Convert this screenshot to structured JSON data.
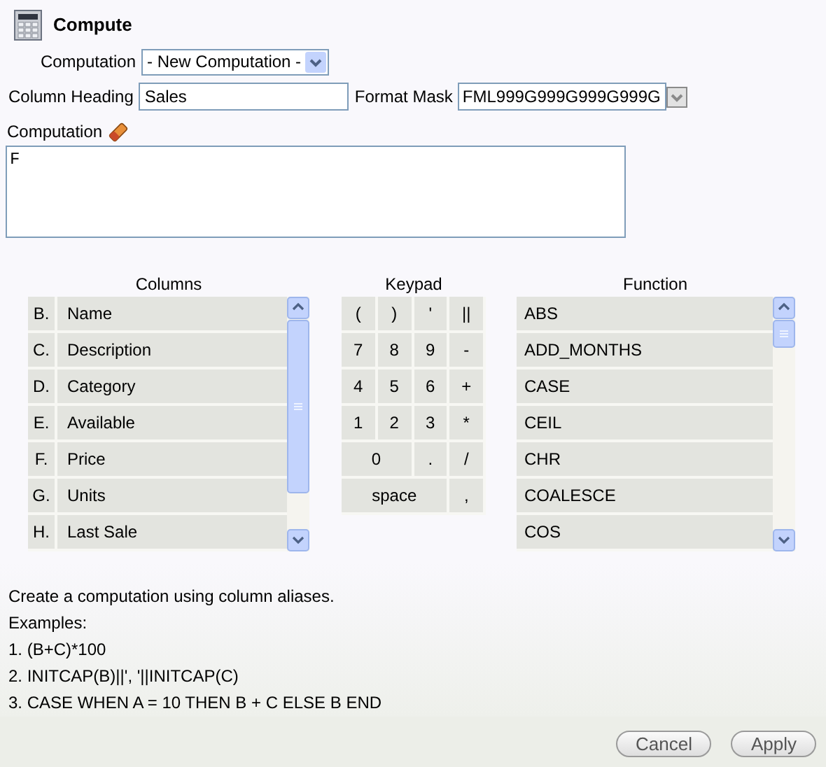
{
  "title": "Compute",
  "computation_select": {
    "label": "Computation",
    "value": "- New Computation -"
  },
  "column_heading": {
    "label": "Column Heading",
    "value": "Sales"
  },
  "format_mask": {
    "label": "Format Mask",
    "value": "FML999G999G999G999G"
  },
  "computation_editor": {
    "label": "Computation",
    "value": "F"
  },
  "columns": {
    "heading": "Columns",
    "items": [
      {
        "alias": "B.",
        "name": "Name"
      },
      {
        "alias": "C.",
        "name": "Description"
      },
      {
        "alias": "D.",
        "name": "Category"
      },
      {
        "alias": "E.",
        "name": "Available"
      },
      {
        "alias": "F.",
        "name": "Price"
      },
      {
        "alias": "G.",
        "name": "Units"
      },
      {
        "alias": "H.",
        "name": "Last Sale"
      }
    ]
  },
  "keypad": {
    "heading": "Keypad",
    "keys": [
      {
        "label": "(",
        "kind": "single"
      },
      {
        "label": ")",
        "kind": "single"
      },
      {
        "label": "'",
        "kind": "single"
      },
      {
        "label": "||",
        "kind": "single"
      },
      {
        "label": "7",
        "kind": "single"
      },
      {
        "label": "8",
        "kind": "single"
      },
      {
        "label": "9",
        "kind": "single"
      },
      {
        "label": "-",
        "kind": "single"
      },
      {
        "label": "4",
        "kind": "single"
      },
      {
        "label": "5",
        "kind": "single"
      },
      {
        "label": "6",
        "kind": "single"
      },
      {
        "label": "+",
        "kind": "single"
      },
      {
        "label": "1",
        "kind": "single"
      },
      {
        "label": "2",
        "kind": "single"
      },
      {
        "label": "3",
        "kind": "single"
      },
      {
        "label": "*",
        "kind": "single"
      },
      {
        "label": "0",
        "kind": "double"
      },
      {
        "label": ".",
        "kind": "single"
      },
      {
        "label": "/",
        "kind": "single"
      },
      {
        "label": "space",
        "kind": "triple"
      },
      {
        "label": ",",
        "kind": "single"
      }
    ]
  },
  "functions": {
    "heading": "Function",
    "items": [
      "ABS",
      "ADD_MONTHS",
      "CASE",
      "CEIL",
      "CHR",
      "COALESCE",
      "COS"
    ]
  },
  "help": {
    "lines": [
      "Create a computation using column aliases.",
      "Examples:",
      "1. (B+C)*100",
      "2. INITCAP(B)||', '||INITCAP(C)",
      "3. CASE WHEN A = 10 THEN B + C ELSE B END"
    ]
  },
  "buttons": [
    "Cancel",
    "Apply"
  ]
}
